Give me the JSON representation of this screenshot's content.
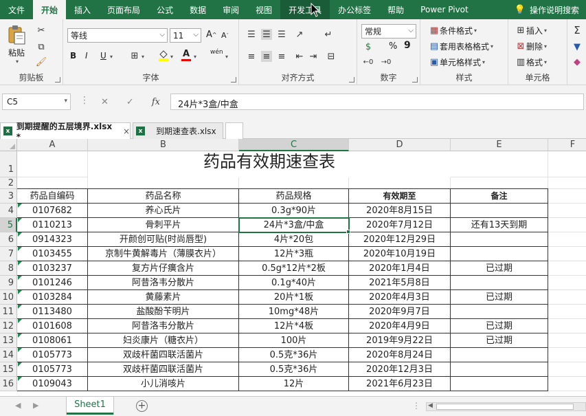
{
  "ribbon_tabs": [
    "文件",
    "开始",
    "插入",
    "页面布局",
    "公式",
    "数据",
    "审阅",
    "视图",
    "开发工具",
    "办公标签",
    "帮助",
    "Power Pivot",
    "操作说明搜索"
  ],
  "active_tab": "开始",
  "clipboard": {
    "paste": "粘贴",
    "group": "剪贴板"
  },
  "font": {
    "name": "等线",
    "size": "11",
    "bold": "B",
    "italic": "I",
    "underline": "U",
    "grow": "A",
    "shrink": "A",
    "phonetic": "wén",
    "group": "字体"
  },
  "alignment": {
    "group": "对齐方式"
  },
  "number": {
    "format": "常规",
    "percent": "%",
    "comma": "9",
    "group": "数字"
  },
  "styles": {
    "conditional": "条件格式",
    "table": "套用表格格式",
    "cell": "单元格样式",
    "group": "样式"
  },
  "cells": {
    "insert": "插入",
    "delete": "删除",
    "format": "格式",
    "group": "单元格"
  },
  "formula_bar": {
    "name_box": "C5",
    "fx": "fx",
    "formula": "24片*3盒/中盒"
  },
  "workbooks": [
    {
      "name": "到期提醒的五层境界.xlsx *",
      "active": true,
      "close": "×"
    },
    {
      "name": "到期速查表.xlsx",
      "active": false
    }
  ],
  "columns": [
    "A",
    "B",
    "C",
    "D",
    "E",
    "F"
  ],
  "selected_column": "C",
  "selected_row": "5",
  "sheet": {
    "title": "药品有效期速查表",
    "headers": [
      "药品自编码",
      "药品名称",
      "药品规格",
      "有效期至",
      "备注"
    ],
    "rows": [
      {
        "num": "4",
        "cells": [
          "0107682",
          "养心氏片",
          "0.3g*90片",
          "2020年8月15日",
          ""
        ]
      },
      {
        "num": "5",
        "cells": [
          "0110213",
          "骨刺平片",
          "24片*3盒/中盒",
          "2020年7月12日",
          "还有13天到期"
        ]
      },
      {
        "num": "6",
        "cells": [
          "0914323",
          "开颜创可贴(时尚唇型)",
          "4片*20包",
          "2020年12月29日",
          ""
        ]
      },
      {
        "num": "7",
        "cells": [
          "0103455",
          "京制牛黄解毒片（薄膜衣片）",
          "12片*3瓶",
          "2020年10月19日",
          ""
        ]
      },
      {
        "num": "8",
        "cells": [
          "0103237",
          "复方片仔癀含片",
          "0.5g*12片*2板",
          "2020年1月4日",
          "已过期"
        ]
      },
      {
        "num": "9",
        "cells": [
          "0101246",
          "阿昔洛韦分散片",
          "0.1g*40片",
          "2021年5月8日",
          ""
        ]
      },
      {
        "num": "10",
        "cells": [
          "0103284",
          "黄藤素片",
          "20片*1板",
          "2020年4月3日",
          "已过期"
        ]
      },
      {
        "num": "11",
        "cells": [
          "0113480",
          "盐酸酚苄明片",
          "10mg*48片",
          "2020年9月7日",
          ""
        ]
      },
      {
        "num": "12",
        "cells": [
          "0101608",
          "阿昔洛韦分散片",
          "12片*4板",
          "2020年4月9日",
          "已过期"
        ]
      },
      {
        "num": "13",
        "cells": [
          "0108061",
          "妇炎康片（糖衣片）",
          "100片",
          "2019年9月22日",
          "已过期"
        ]
      },
      {
        "num": "14",
        "cells": [
          "0105773",
          "双歧杆菌四联活菌片",
          "0.5克*36片",
          "2020年8月24日",
          ""
        ]
      },
      {
        "num": "15",
        "cells": [
          "0105773",
          "双歧杆菌四联活菌片",
          "0.5克*36片",
          "2020年12月3日",
          ""
        ]
      },
      {
        "num": "16",
        "cells": [
          "0109043",
          "小儿消咳片",
          "12片",
          "2021年6月23日",
          ""
        ]
      }
    ]
  },
  "sheet_tabs": [
    "Sheet1"
  ],
  "colors": {
    "accent": "#217346",
    "error_triangle": "#1f8a4c"
  }
}
